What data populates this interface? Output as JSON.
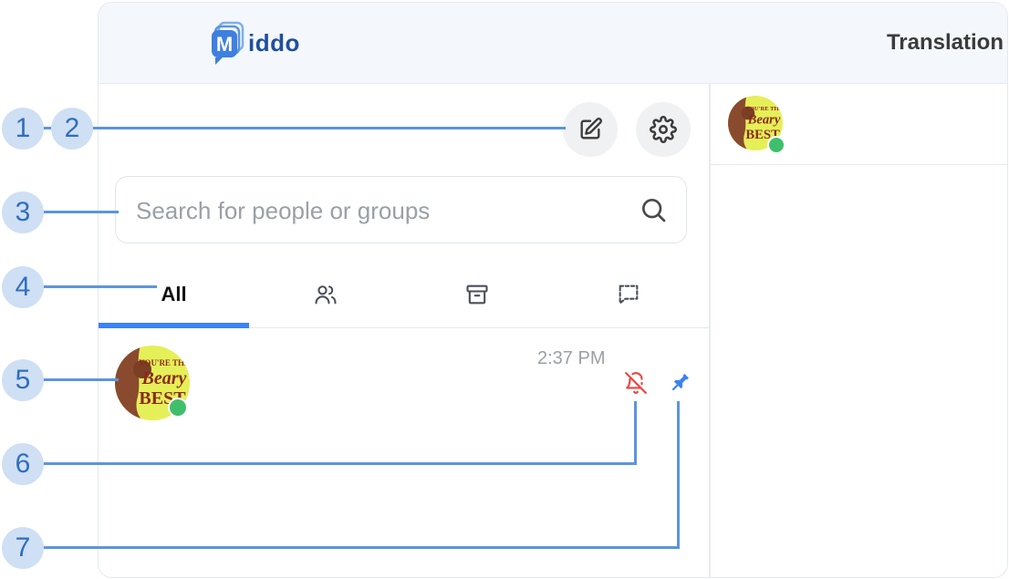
{
  "app": {
    "logo_text": "iddo",
    "logo_letter": "M",
    "header_title": "Translation"
  },
  "search": {
    "placeholder": "Search for people or groups"
  },
  "tabs": [
    {
      "label": "All",
      "icon": "all",
      "active": true
    },
    {
      "label": "",
      "icon": "users-icon"
    },
    {
      "label": "",
      "icon": "archive-icon"
    },
    {
      "label": "",
      "icon": "dashed-message-icon"
    }
  ],
  "chat_list": [
    {
      "name": "",
      "time": "2:37 PM",
      "muted": true,
      "pinned": true,
      "online": true,
      "avatar_text": [
        "YOU'RE THE",
        "Beary",
        "BEST"
      ]
    }
  ],
  "active_chat": {
    "online": true
  },
  "markers": [
    "1",
    "2",
    "3",
    "4",
    "5",
    "6",
    "7"
  ],
  "colors": {
    "accent": "#3b82f6",
    "annotation_line": "#5b95dd",
    "marker_bg": "#cfdff4",
    "marker_text": "#2f6fbd",
    "muted_icon": "#ef4444",
    "pin_icon": "#3b82f6",
    "online": "#3fbf6b"
  }
}
